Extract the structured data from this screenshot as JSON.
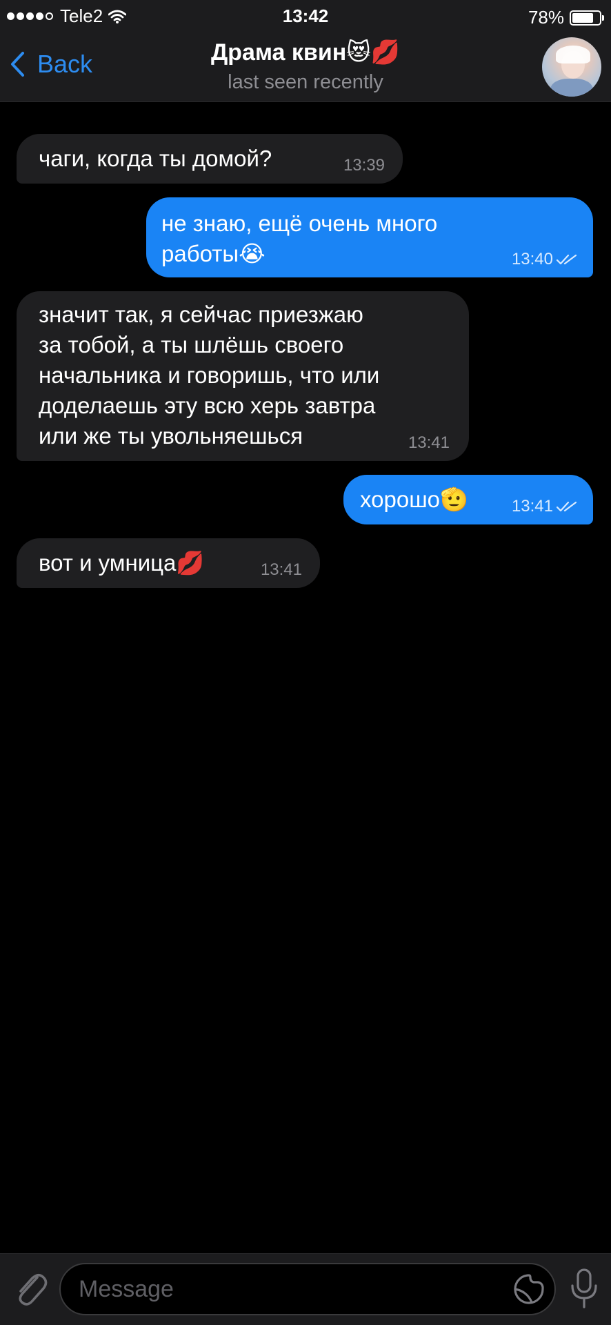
{
  "status_bar": {
    "carrier": "Tele2",
    "signal_bars_filled": 4,
    "signal_bars_total": 5,
    "time": "13:42",
    "battery_percent": "78%",
    "battery_level": 0.78
  },
  "header": {
    "back_label": "Back",
    "title": "Драма квин😻💋",
    "subtitle": "last seen recently",
    "accent_color": "#2d8cf0"
  },
  "messages": [
    {
      "direction": "incoming",
      "text": "чаги, когда ты домой?",
      "time": "13:39"
    },
    {
      "direction": "outgoing",
      "text": "не знаю, ещё очень много\nработы😭",
      "time": "13:40",
      "read": true
    },
    {
      "direction": "incoming",
      "text": "значит так, я сейчас приезжаю\nза тобой, а ты шлёшь своего\nначальника и говоришь, что или\nдоделаешь эту всю херь завтра\nили же ты увольняешься",
      "time": "13:41"
    },
    {
      "direction": "outgoing",
      "text": "хорошо🫡",
      "time": "13:41",
      "read": true
    },
    {
      "direction": "incoming",
      "text": "вот и умница💋",
      "time": "13:41"
    }
  ],
  "input": {
    "placeholder": "Message"
  },
  "colors": {
    "background": "#000000",
    "bars": "#1c1c1e",
    "incoming_bubble": "#1f1f21",
    "outgoing_bubble": "#1a84f5",
    "secondary_text": "#8e8e93"
  }
}
